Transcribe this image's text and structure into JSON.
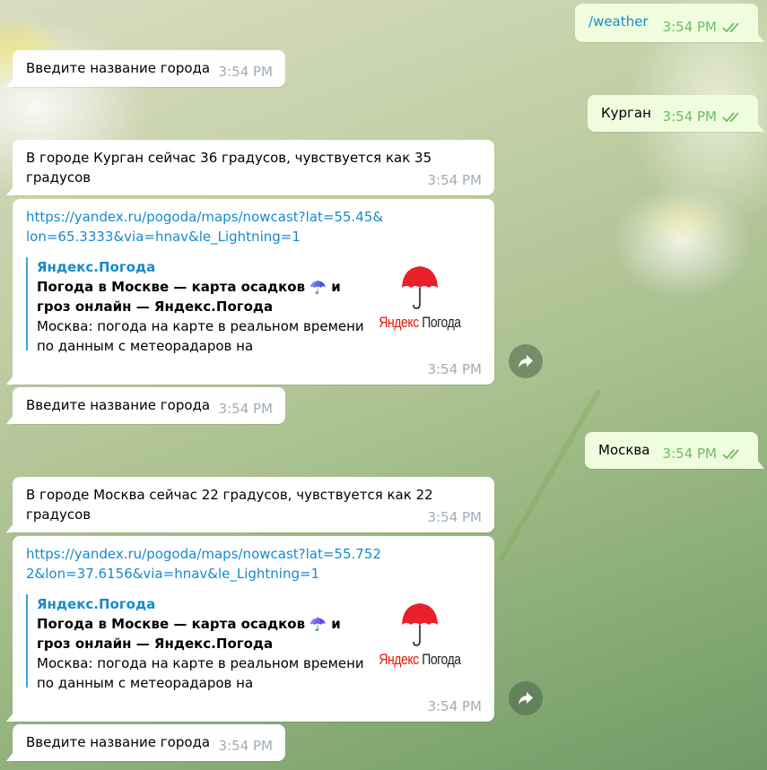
{
  "messages": {
    "m1": {
      "text": "/weather",
      "time": "3:54 PM"
    },
    "m2": {
      "text": "Введите название города",
      "time": "3:54 PM"
    },
    "m3": {
      "text": "Курган",
      "time": "3:54 PM"
    },
    "m4": {
      "text": "В городе Курган сейчас 36 градусов, чувствуется как 35 градусов",
      "time": "3:54 PM"
    },
    "m5": {
      "link": "https://yandex.ru/pogoda/maps/nowcast?lat=55.45&lon=65.3333&via=hnav&le_Lightning=1",
      "site": "Яндекс.Погода",
      "title": "Погода в Москве — карта осадков ☂️ и гроз онлайн — Яндекс.Погода",
      "desc": "Москва: погода на карте в реальном времени по данным с метеорадаров на Яндекс.Погоде....",
      "time": "3:54 PM"
    },
    "m6": {
      "text": "Введите название города",
      "time": "3:54 PM"
    },
    "m7": {
      "text": "Москва",
      "time": "3:54 PM"
    },
    "m8": {
      "text": "В городе Москва сейчас 22 градусов, чувствуется как 22 градусов",
      "time": "3:54 PM"
    },
    "m9": {
      "link": "https://yandex.ru/pogoda/maps/nowcast?lat=55.7522&lon=37.6156&via=hnav&le_Lightning=1",
      "site": "Яндекс.Погода",
      "title": "Погода в Москве — карта осадков ☂️ и гроз онлайн — Яндекс.Погода",
      "desc": "Москва: погода на карте в реальном времени по данным с метеорадаров на Яндекс.Погоде....",
      "time": "3:54 PM"
    },
    "m10": {
      "text": "Введите название города",
      "time": "3:54 PM"
    }
  },
  "logo": {
    "ya": "Яндекс",
    "pogoda": "Погода"
  },
  "icons": {
    "umbrella": "umbrella-icon",
    "share": "share-icon",
    "ticks": "double-check-icon"
  },
  "colors": {
    "link": "#168acd",
    "outgoing_bg": "#effdde",
    "read_ticks": "#6dbc62",
    "logo_red": "#e61400"
  }
}
